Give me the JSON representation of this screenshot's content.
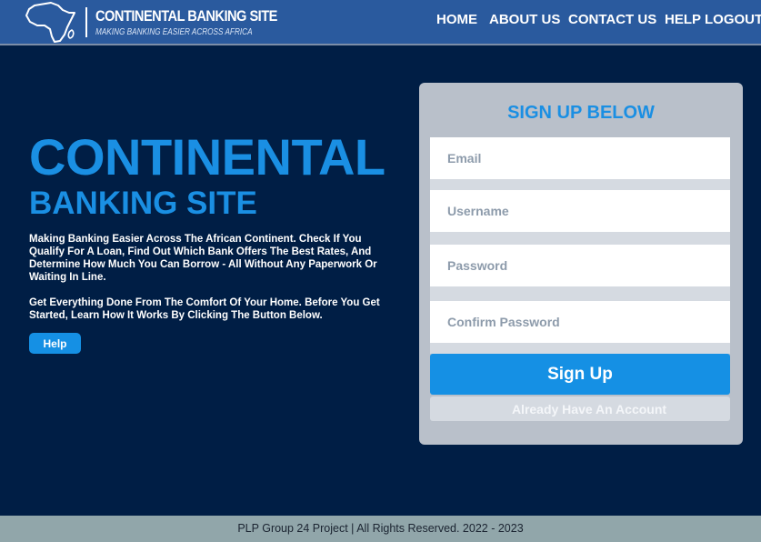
{
  "header": {
    "brand_title": "CONTINENTAL BANKING SITE",
    "brand_tagline": "MAKING BANKING EASIER ACROSS AFRICA",
    "nav": [
      "HOME",
      "ABOUT US",
      "CONTACT US",
      "HELP",
      "LOGOUT"
    ]
  },
  "hero": {
    "title": "CONTINENTAL",
    "subtitle": "BANKING SITE",
    "paragraph1": "Making Banking Easier Across The African Continent. Check If You Qualify  For A Loan, Find Out Which Bank Offers The Best Rates, And Determine How Much You Can Borrow - All Without Any Paperwork Or Waiting In Line.",
    "paragraph2": "Get Everything Done From The Comfort Of Your Home. Before You Get Started, Learn How It Works By Clicking The Button Below.",
    "help_label": "Help"
  },
  "signup": {
    "title": "SIGN UP BELOW",
    "email_placeholder": "Email",
    "username_placeholder": "Username",
    "password_placeholder": "Password",
    "confirm_placeholder": "Confirm Password",
    "submit_label": "Sign Up",
    "already_label": "Already Have An Account"
  },
  "footer": {
    "text": "PLP Group 24 Project | All Rights Reserved. 2022 - 2023"
  },
  "colors": {
    "header_bg": "#2a5a9e",
    "page_bg": "#001e45",
    "accent": "#1a8fe3",
    "card_bg": "#b9c0ca",
    "footer_bg": "#91a6aa"
  }
}
